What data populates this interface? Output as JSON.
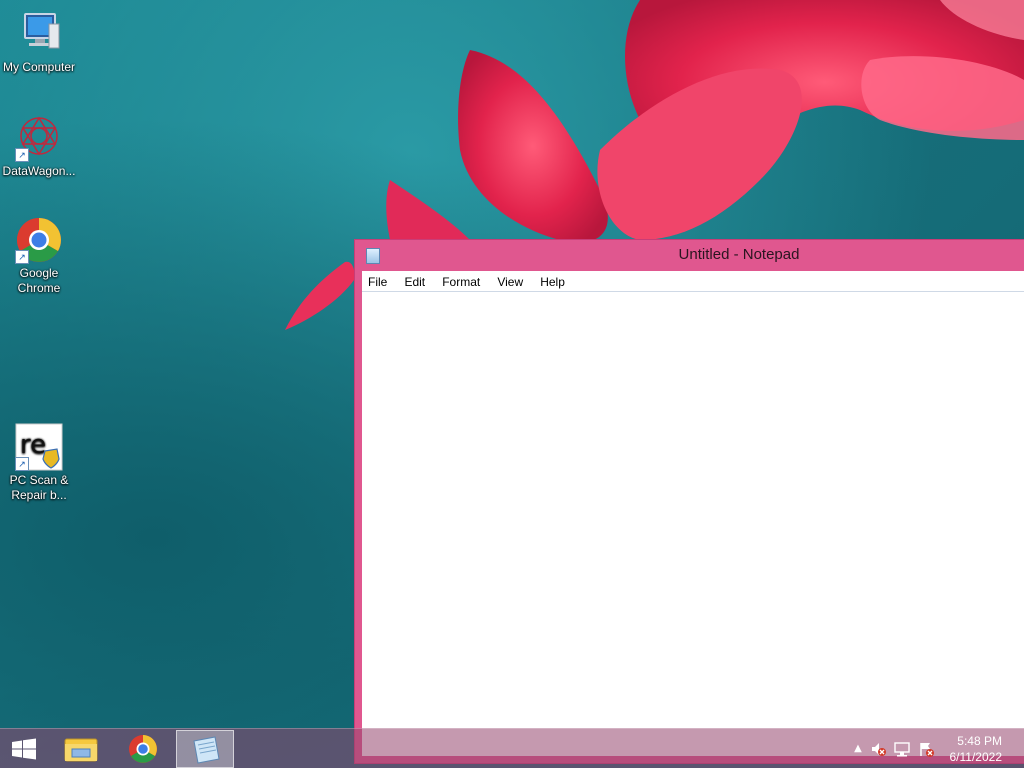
{
  "desktop": {
    "icons": [
      {
        "label": "My Computer",
        "icon": "computer-icon"
      },
      {
        "label": "DataWagon...",
        "icon": "datawagon-icon"
      },
      {
        "label": "Google Chrome",
        "icon": "chrome-icon"
      },
      {
        "label": "PC Scan & Repair b...",
        "icon": "reimage-icon"
      }
    ]
  },
  "notepad": {
    "title": "Untitled - Notepad",
    "menu": [
      "File",
      "Edit",
      "Format",
      "View",
      "Help"
    ],
    "content": ""
  },
  "taskbar": {
    "buttons": [
      {
        "icon": "windows-start-icon"
      },
      {
        "icon": "file-explorer-icon"
      },
      {
        "icon": "chrome-icon"
      },
      {
        "icon": "notepad-icon"
      }
    ],
    "tray": {
      "icons": [
        "show-hidden-icons-icon",
        "speaker-muted-icon",
        "network-icon",
        "action-center-icon"
      ],
      "time": "5:48 PM",
      "date": "6/11/2022"
    }
  },
  "colors": {
    "window_frame": "#e0578f",
    "desktop_teal": "#1d8a95",
    "flower_red": "#e8244f"
  }
}
